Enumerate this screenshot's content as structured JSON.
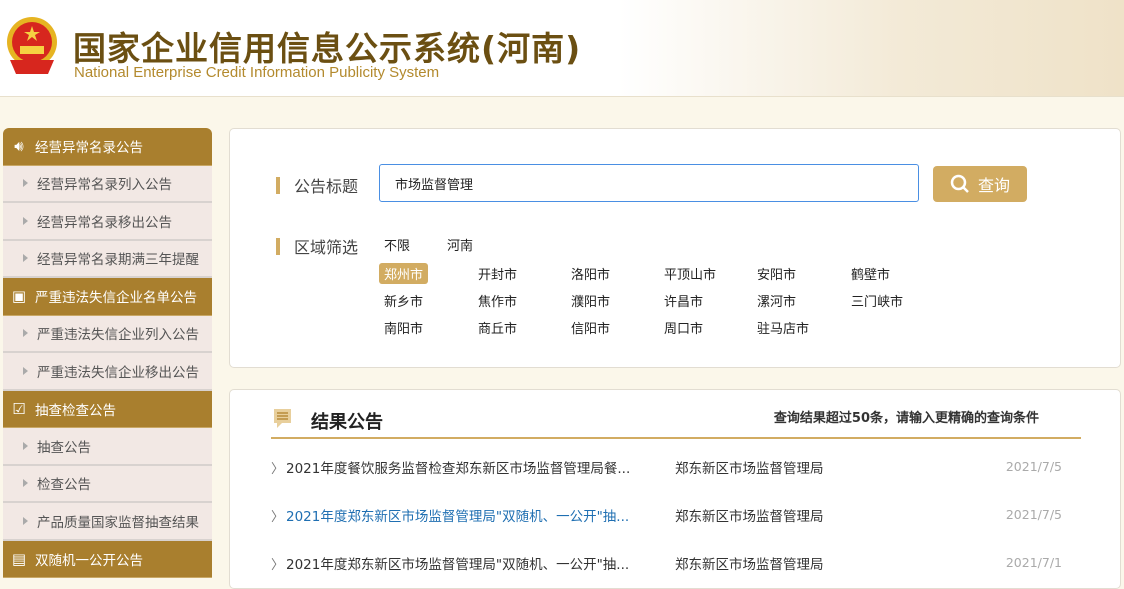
{
  "header": {
    "title_cn": "国家企业信用信息公示系统(河南)",
    "title_en": "National Enterprise Credit Information Publicity System"
  },
  "sidebar": [
    {
      "label": "经营异常名录公告",
      "icon": "speaker-icon",
      "items": [
        "经营异常名录列入公告",
        "经营异常名录移出公告",
        "经营异常名录期满三年提醒"
      ]
    },
    {
      "label": "严重违法失信企业名单公告",
      "icon": "calendar-alert-icon",
      "items": [
        "严重违法失信企业列入公告",
        "严重违法失信企业移出公告"
      ]
    },
    {
      "label": "抽查检查公告",
      "icon": "checkbox-icon",
      "items": [
        "抽查公告",
        "检查公告",
        "产品质量国家监督抽查结果"
      ]
    },
    {
      "label": "双随机一公开公告",
      "icon": "box-icon",
      "items": []
    }
  ],
  "search": {
    "label": "公告标题",
    "value": "市场监督管理",
    "button": "查询"
  },
  "region": {
    "label": "区域筛选",
    "top": [
      "不限",
      "河南"
    ],
    "cities": [
      "郑州市",
      "开封市",
      "洛阳市",
      "平顶山市",
      "安阳市",
      "鹤壁市",
      "新乡市",
      "焦作市",
      "濮阳市",
      "许昌市",
      "漯河市",
      "三门峡市",
      "南阳市",
      "商丘市",
      "信阳市",
      "周口市",
      "驻马店市"
    ],
    "selected": "郑州市"
  },
  "results": {
    "title": "结果公告",
    "note": "查询结果超过50条，请输入更精确的查询条件",
    "rows": [
      {
        "title": "2021年度餐饮服务监督检查郑东新区市场监督管理局餐...",
        "org": "郑东新区市场监督管理局",
        "date": "2021/7/5"
      },
      {
        "title": "2021年度郑东新区市场监督管理局\"双随机、一公开\"抽...",
        "org": "郑东新区市场监督管理局",
        "date": "2021/7/5"
      },
      {
        "title": "2021年度郑东新区市场监督管理局\"双随机、一公开\"抽...",
        "org": "郑东新区市场监督管理局",
        "date": "2021/7/1"
      }
    ]
  },
  "colors": {
    "accent": "#d2ac62",
    "sidebar": "#a97f2e",
    "link": "#1f6fb2"
  }
}
